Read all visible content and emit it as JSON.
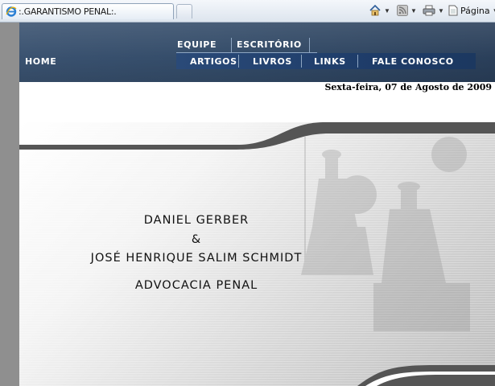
{
  "browser": {
    "tab_title": ":.GARANTISMO PENAL:.",
    "tab_icon": "ie-icon",
    "toolbar": {
      "home_icon": "home-icon",
      "feeds_icon": "rss-icon",
      "print_icon": "print-icon",
      "page_icon": "page-icon",
      "page_label": "Página"
    }
  },
  "site": {
    "nav": {
      "home": "HOME",
      "top_items": [
        "EQUIPE",
        "ESCRITÓRIO"
      ],
      "bottom_items": [
        "ARTIGOS",
        "LIVROS",
        "LINKS",
        "FALE CONOSCO"
      ]
    },
    "date": "Sexta-feira, 07 de Agosto de 2009",
    "hero": {
      "line1": "DANIEL GERBER",
      "line2": "&",
      "line3": "JOSÉ HENRIQUE SALIM SCHMIDT",
      "line4": "ADVOCACIA PENAL"
    },
    "colors": {
      "header": "#334b68",
      "nav_bar": "#1f3d6a",
      "swoosh": "#555555"
    }
  }
}
